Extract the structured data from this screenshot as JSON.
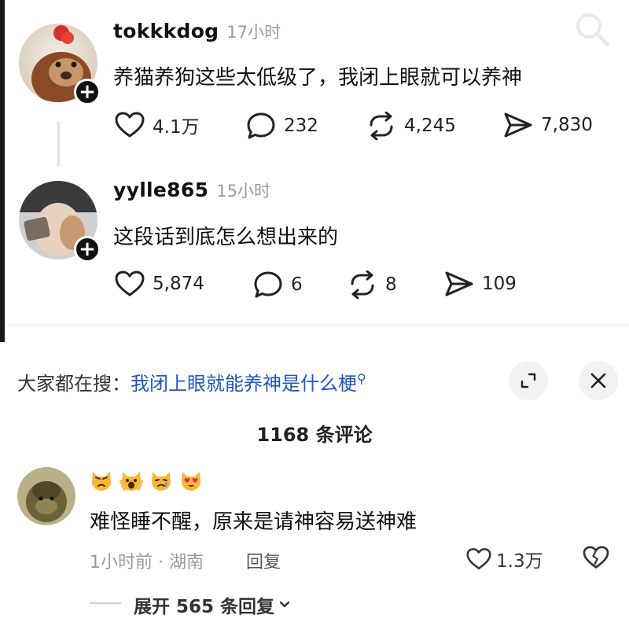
{
  "header": {
    "search_icon": "search-icon"
  },
  "posts": [
    {
      "username": "tokkkdog",
      "time": "17小时",
      "text": "养猫养狗这些太低级了，我闭上眼就可以养神",
      "likes": "4.1万",
      "comments": "232",
      "reposts": "4,245",
      "shares": "7,830"
    },
    {
      "username": "yylle865",
      "time": "15小时",
      "text": "这段话到底怎么想出来的",
      "likes": "5,874",
      "comments": "6",
      "reposts": "8",
      "shares": "109"
    }
  ],
  "search_suggestion": {
    "lead": "大家都在搜：",
    "query": "我闭上眼就能养神是什么梗"
  },
  "comments_header": {
    "title": "1168 条评论"
  },
  "comment": {
    "emojis": [
      "pouting-cat",
      "weary-cat",
      "crying-cat",
      "heart-eyes-cat"
    ],
    "text": "难怪睡不醒，原来是请神容易送神难",
    "meta": "1小时前 · 湖南",
    "reply_label": "回复",
    "likes": "1.3万",
    "expand_label": "展开 565 条回复"
  },
  "colors": {
    "link": "#1f57c3",
    "muted": "#9a9a9a"
  }
}
